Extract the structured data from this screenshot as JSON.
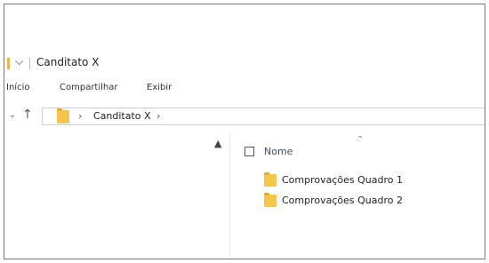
{
  "window": {
    "title": "Canditato X",
    "quick_access_icon": "dropdown-arrow-icon",
    "accent_color": "#e8b64a"
  },
  "ribbon": {
    "tabs": [
      {
        "label": "Início"
      },
      {
        "label": "Compartilhar"
      },
      {
        "label": "Exibir"
      }
    ]
  },
  "navigation": {
    "back_chevron_icon": "chevron-down-icon",
    "up_icon": "up-arrow-icon",
    "separator": "›",
    "breadcrumb": "Canditato X",
    "trailing_separator": "›"
  },
  "list_header": {
    "name_column": "Nome"
  },
  "files": [
    {
      "name": "Comprovações Quadro 1",
      "type": "folder"
    },
    {
      "name": "Comprovações Quadro 2",
      "type": "folder"
    }
  ]
}
